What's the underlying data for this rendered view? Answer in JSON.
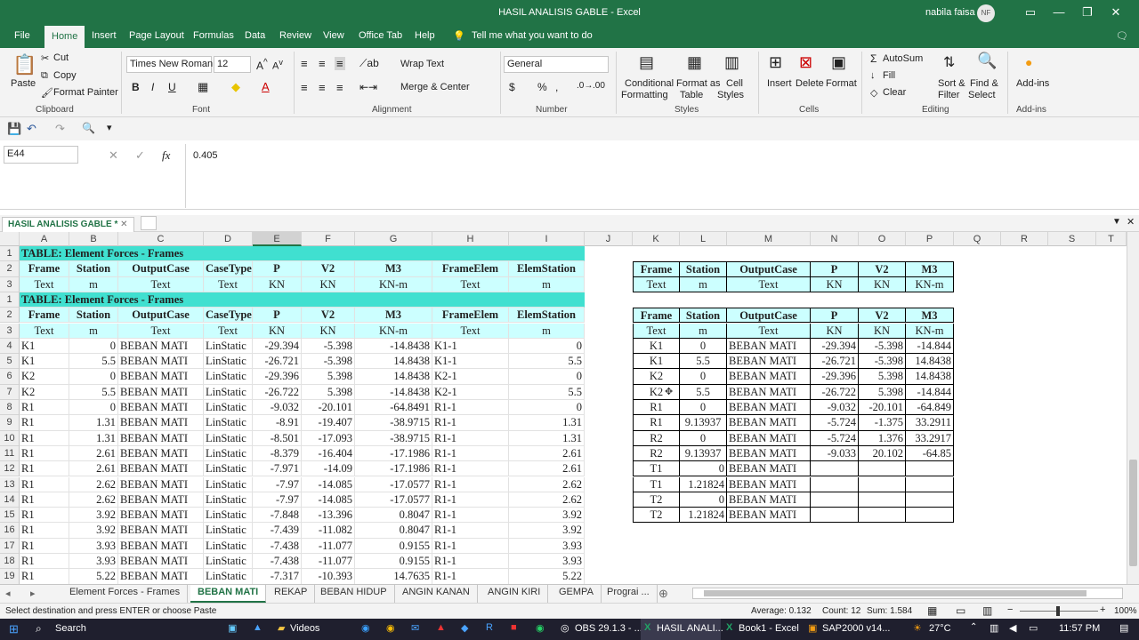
{
  "window": {
    "title": "HASIL ANALISIS GABLE  -  Excel",
    "user": "nabila faisa",
    "avatar": "NF"
  },
  "ribbon_tabs": [
    "File",
    "Home",
    "Insert",
    "Page Layout",
    "Formulas",
    "Data",
    "Review",
    "View",
    "Office Tab",
    "Help"
  ],
  "tell_me": "Tell me what you want to do",
  "clipboard": {
    "paste": "Paste",
    "cut": "Cut",
    "copy": "Copy",
    "format_painter": "Format Painter",
    "group": "Clipboard"
  },
  "font": {
    "name": "Times New Roman",
    "size": "12",
    "group": "Font"
  },
  "alignment": {
    "wrap": "Wrap Text",
    "merge": "Merge & Center",
    "group": "Alignment"
  },
  "number": {
    "format": "General",
    "group": "Number"
  },
  "styles": {
    "conditional": "Conditional",
    "conditional2": "Formatting",
    "format_as": "Format as",
    "format_as2": "Table",
    "cell": "Cell",
    "cell2": "Styles",
    "group": "Styles"
  },
  "cells": {
    "insert": "Insert",
    "delete": "Delete",
    "format": "Format",
    "group": "Cells"
  },
  "editing": {
    "autosum": "AutoSum",
    "fill": "Fill",
    "clear": "Clear",
    "sort": "Sort &",
    "sort2": "Filter",
    "find": "Find &",
    "find2": "Select",
    "group": "Editing"
  },
  "addins": {
    "label": "Add-ins",
    "group": "Add-ins"
  },
  "formula_bar": {
    "name_box": "E44",
    "fx": "fx",
    "value": "0.405"
  },
  "workbook_tab": "HASIL ANALISIS GABLE *",
  "columns": [
    "A",
    "B",
    "C",
    "D",
    "E",
    "F",
    "G",
    "H",
    "I",
    "J",
    "K",
    "L",
    "M",
    "N",
    "O",
    "P",
    "Q",
    "R",
    "S",
    "T"
  ],
  "rows": [
    "1",
    "2",
    "3",
    "1",
    "2",
    "3",
    "4",
    "5",
    "6",
    "7",
    "8",
    "9",
    "10",
    "11",
    "12",
    "13",
    "14",
    "15",
    "16",
    "17",
    "18",
    "19"
  ],
  "table_title": "TABLE:  Element Forces - Frames",
  "left_headers": [
    "Frame",
    "Station",
    "OutputCase",
    "CaseType",
    "P",
    "V2",
    "M3",
    "FrameElem",
    "ElemStation"
  ],
  "left_units": [
    "Text",
    "m",
    "Text",
    "Text",
    "KN",
    "KN",
    "KN-m",
    "Text",
    "m"
  ],
  "left_data": [
    [
      "K1",
      "0",
      "BEBAN MATI",
      "LinStatic",
      "-29.394",
      "-5.398",
      "-14.8438",
      "K1-1",
      "0"
    ],
    [
      "K1",
      "5.5",
      "BEBAN MATI",
      "LinStatic",
      "-26.721",
      "-5.398",
      "14.8438",
      "K1-1",
      "5.5"
    ],
    [
      "K2",
      "0",
      "BEBAN MATI",
      "LinStatic",
      "-29.396",
      "5.398",
      "14.8438",
      "K2-1",
      "0"
    ],
    [
      "K2",
      "5.5",
      "BEBAN MATI",
      "LinStatic",
      "-26.722",
      "5.398",
      "-14.8438",
      "K2-1",
      "5.5"
    ],
    [
      "R1",
      "0",
      "BEBAN MATI",
      "LinStatic",
      "-9.032",
      "-20.101",
      "-64.8491",
      "R1-1",
      "0"
    ],
    [
      "R1",
      "1.31",
      "BEBAN MATI",
      "LinStatic",
      "-8.91",
      "-19.407",
      "-38.9715",
      "R1-1",
      "1.31"
    ],
    [
      "R1",
      "1.31",
      "BEBAN MATI",
      "LinStatic",
      "-8.501",
      "-17.093",
      "-38.9715",
      "R1-1",
      "1.31"
    ],
    [
      "R1",
      "2.61",
      "BEBAN MATI",
      "LinStatic",
      "-8.379",
      "-16.404",
      "-17.1986",
      "R1-1",
      "2.61"
    ],
    [
      "R1",
      "2.61",
      "BEBAN MATI",
      "LinStatic",
      "-7.971",
      "-14.09",
      "-17.1986",
      "R1-1",
      "2.61"
    ],
    [
      "R1",
      "2.62",
      "BEBAN MATI",
      "LinStatic",
      "-7.97",
      "-14.085",
      "-17.0577",
      "R1-1",
      "2.62"
    ],
    [
      "R1",
      "2.62",
      "BEBAN MATI",
      "LinStatic",
      "-7.97",
      "-14.085",
      "-17.0577",
      "R1-1",
      "2.62"
    ],
    [
      "R1",
      "3.92",
      "BEBAN MATI",
      "LinStatic",
      "-7.848",
      "-13.396",
      "0.8047",
      "R1-1",
      "3.92"
    ],
    [
      "R1",
      "3.92",
      "BEBAN MATI",
      "LinStatic",
      "-7.439",
      "-11.082",
      "0.8047",
      "R1-1",
      "3.92"
    ],
    [
      "R1",
      "3.93",
      "BEBAN MATI",
      "LinStatic",
      "-7.438",
      "-11.077",
      "0.9155",
      "R1-1",
      "3.93"
    ],
    [
      "R1",
      "3.93",
      "BEBAN MATI",
      "LinStatic",
      "-7.438",
      "-11.077",
      "0.9155",
      "R1-1",
      "3.93"
    ],
    [
      "R1",
      "5.22",
      "BEBAN MATI",
      "LinStatic",
      "-7.317",
      "-10.393",
      "14.7635",
      "R1-1",
      "5.22"
    ]
  ],
  "right_headers": [
    "Frame",
    "Station",
    "OutputCase",
    "P",
    "V2",
    "M3"
  ],
  "right_units": [
    "Text",
    "m",
    "Text",
    "KN",
    "KN",
    "KN-m"
  ],
  "right_data": [
    [
      "K1",
      "0",
      "BEBAN MATI",
      "-29.394",
      "-5.398",
      "-14.844"
    ],
    [
      "K1",
      "5.5",
      "BEBAN MATI",
      "-26.721",
      "-5.398",
      "14.8438"
    ],
    [
      "K2",
      "0",
      "BEBAN MATI",
      "-29.396",
      "5.398",
      "14.8438"
    ],
    [
      "K2",
      "5.5",
      "BEBAN MATI",
      "-26.722",
      "5.398",
      "-14.844"
    ],
    [
      "R1",
      "0",
      "BEBAN MATI",
      "-9.032",
      "-20.101",
      "-64.849"
    ],
    [
      "R1",
      "9.13937",
      "BEBAN MATI",
      "-5.724",
      "-1.375",
      "33.2911"
    ],
    [
      "R2",
      "0",
      "BEBAN MATI",
      "-5.724",
      "1.376",
      "33.2917"
    ],
    [
      "R2",
      "9.13937",
      "BEBAN MATI",
      "-9.033",
      "20.102",
      "-64.85"
    ],
    [
      "T1",
      "0",
      "BEBAN MATI",
      "",
      "",
      ""
    ],
    [
      "T1",
      "1.21824",
      "BEBAN MATI",
      "",
      "",
      ""
    ],
    [
      "T2",
      "0",
      "BEBAN MATI",
      "",
      "",
      ""
    ],
    [
      "T2",
      "1.21824",
      "BEBAN MATI",
      "",
      "",
      ""
    ]
  ],
  "sheet_tabs": [
    "Element Forces - Frames",
    "BEBAN MATI",
    "REKAP",
    "BEBAN HIDUP",
    "ANGIN KANAN",
    "ANGIN KIRI",
    "GEMPA",
    "Prograi ..."
  ],
  "status": {
    "message": "Select destination and press ENTER or choose Paste",
    "average": "Average: 0.132",
    "count": "Count: 12",
    "sum": "Sum: 1.584",
    "zoom": "100%"
  },
  "taskbar": {
    "search": "Search",
    "videos": "Videos",
    "obs": "OBS 29.1.3 - ...",
    "excel1": "HASIL ANALI...",
    "excel2": "Book1 - Excel",
    "sap": "SAP2000 v14...",
    "temp": "27°C",
    "time": "11:57 PM"
  }
}
